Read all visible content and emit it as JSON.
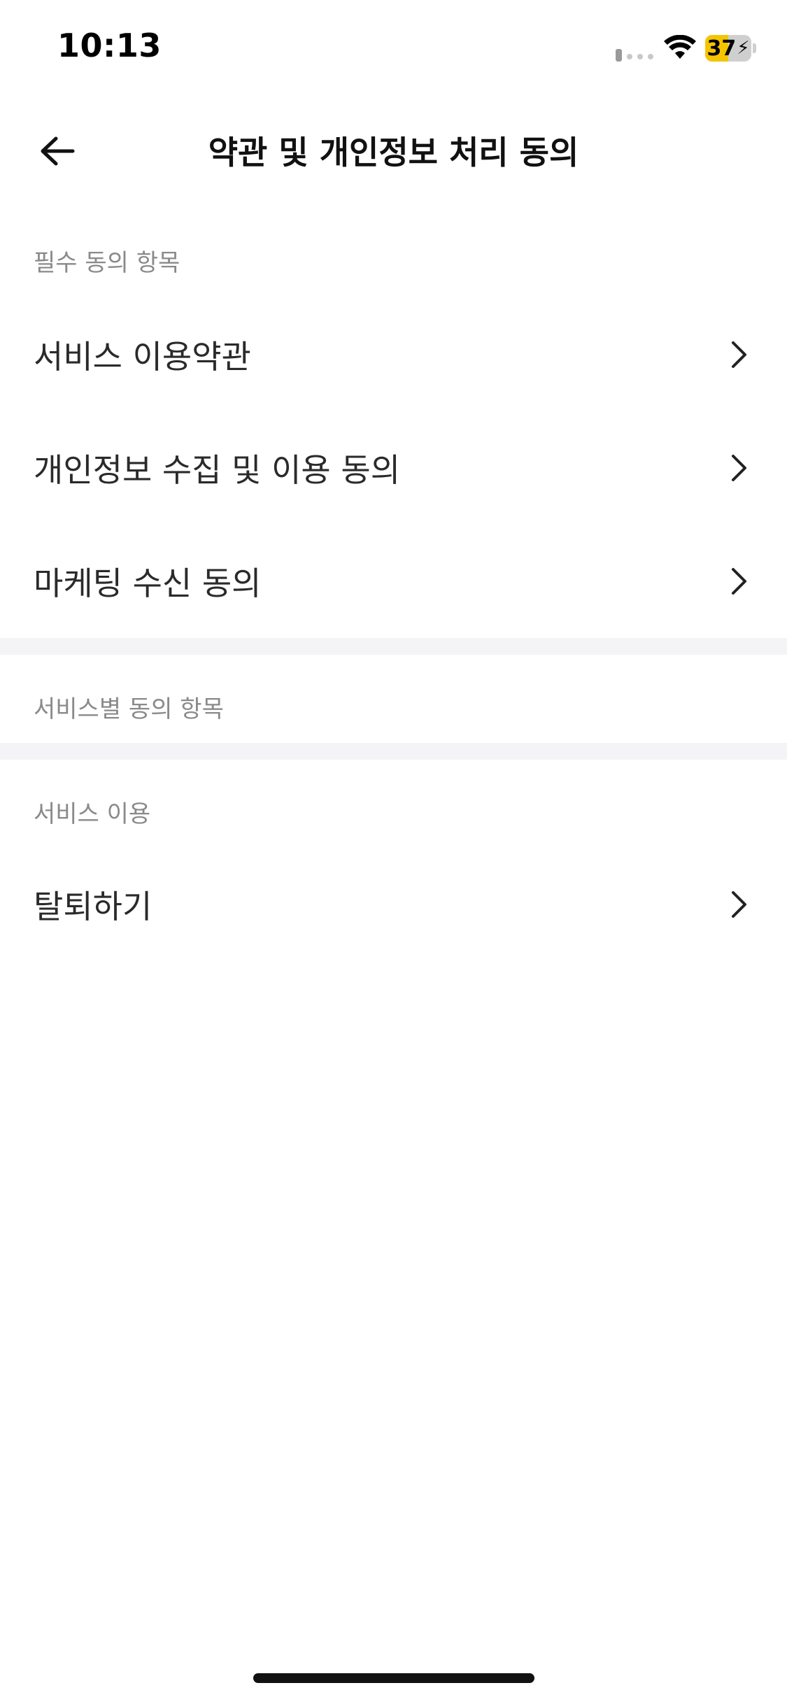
{
  "status_bar": {
    "time": "10:13",
    "battery_level": "37",
    "battery_fraction": 0.37,
    "battery_color": "#f5c400",
    "icons": [
      "cellular-signal-icon",
      "wifi-icon",
      "battery-charging-icon"
    ]
  },
  "header": {
    "title": "약관 및 개인정보 처리 동의",
    "back_icon": "arrow-left-icon"
  },
  "sections": [
    {
      "label": "필수 동의 항목",
      "items": [
        {
          "label": "서비스 이용약관"
        },
        {
          "label": "개인정보 수집 및 이용 동의"
        },
        {
          "label": "마케팅 수신 동의"
        }
      ]
    },
    {
      "label": "서비스별 동의 항목",
      "items": []
    },
    {
      "label": "서비스 이용",
      "items": [
        {
          "label": "탈퇴하기"
        }
      ]
    }
  ],
  "colors": {
    "section_label": "#8a8a8a",
    "divider_band": "#f4f4f6"
  }
}
